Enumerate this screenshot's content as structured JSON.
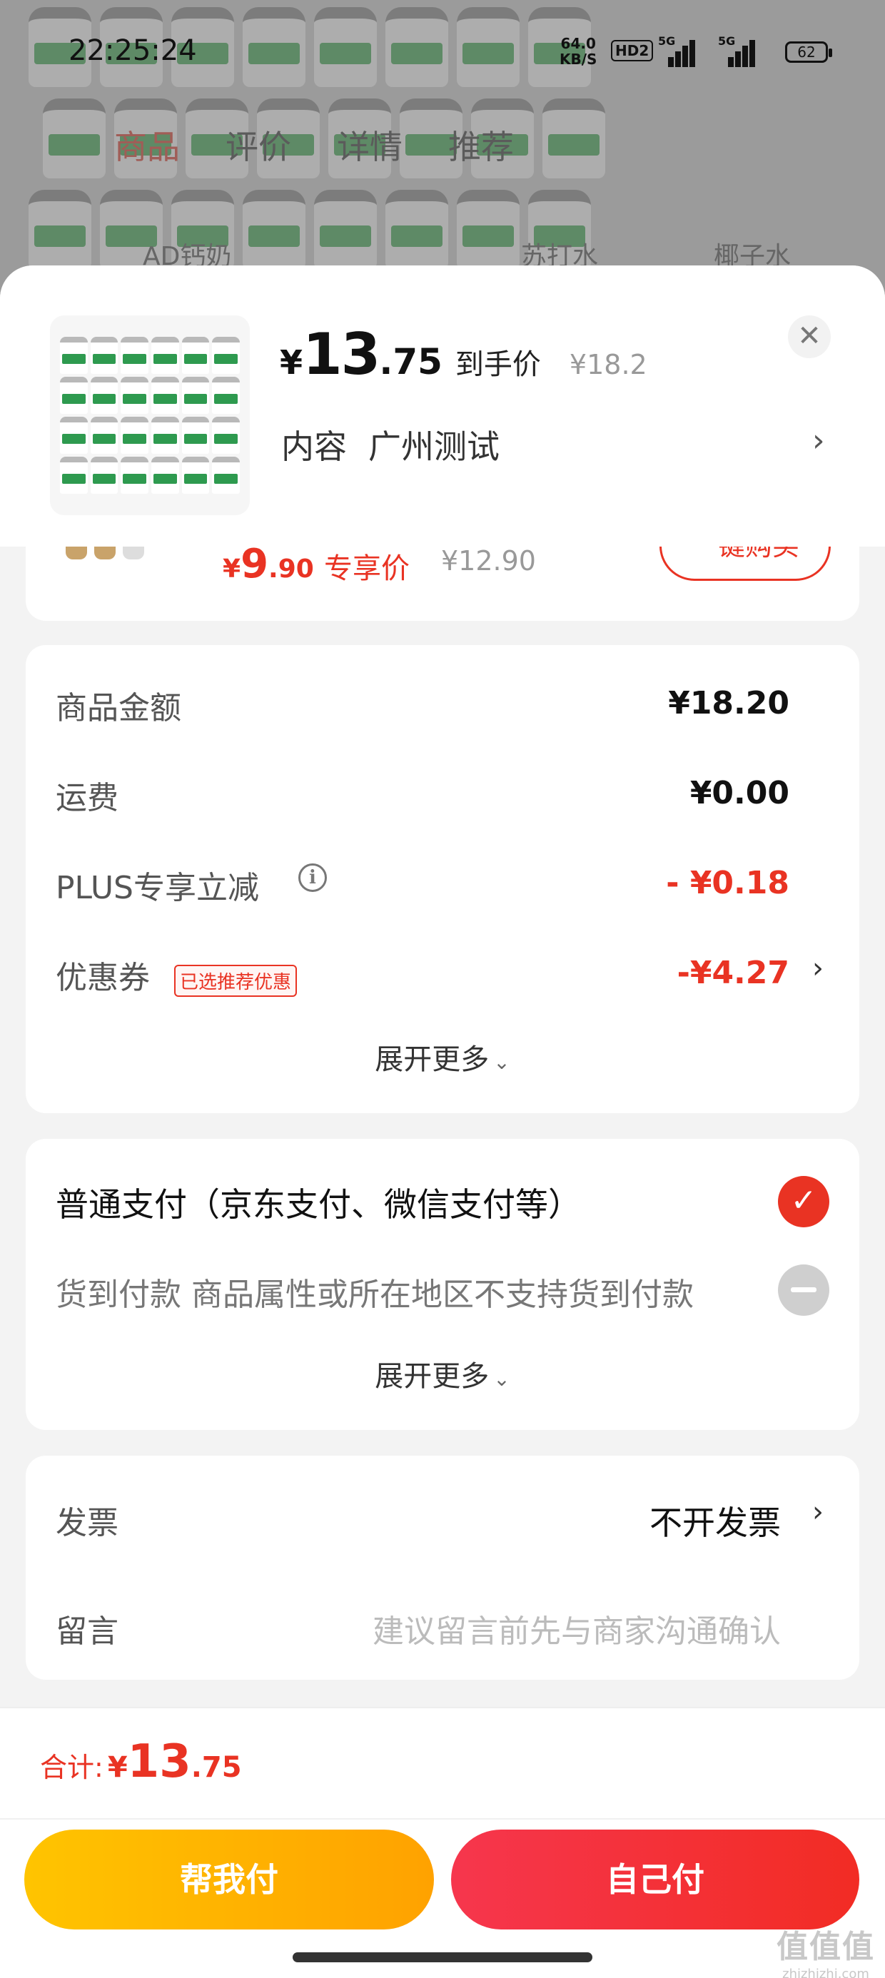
{
  "status_bar": {
    "time": "22:25:24",
    "net_speed": "64.0",
    "net_unit": "KB/S",
    "hd": "HD2",
    "sig1": "5G",
    "sig2": "5G",
    "battery": "62"
  },
  "background": {
    "tabs": [
      "商品",
      "评价",
      "详情",
      "推荐"
    ],
    "active_tab": "商品",
    "row_items": [
      "AD钙奶",
      "苏打水",
      "椰子水"
    ]
  },
  "product": {
    "price_currency": "¥",
    "price_int": "13",
    "price_dec": ".75",
    "price_tag": "到手价",
    "original_price": "¥18.2",
    "spec_label": "内容",
    "spec_value": "广州测试"
  },
  "recommend": {
    "price_currency": "¥",
    "price_int": "9",
    "price_dec": ".90",
    "price_tag": "专享价",
    "original_price": "¥12.90",
    "button_label": "一键购买"
  },
  "fees": {
    "goods_label": "商品金额",
    "goods_value": "¥18.20",
    "shipping_label": "运费",
    "shipping_value": "¥0.00",
    "plus_label": "PLUS专享立减",
    "plus_value": "- ¥0.18",
    "coupon_label": "优惠券",
    "coupon_badge": "已选推荐优惠",
    "coupon_value": "-¥4.27",
    "expand_label": "展开更多"
  },
  "payment": {
    "normal_label": "普通支付（京东支付、微信支付等）",
    "cod_label": "货到付款 商品属性或所在地区不支持货到付款",
    "expand_label": "展开更多"
  },
  "invoice": {
    "invoice_label": "发票",
    "invoice_value": "不开发票",
    "message_label": "留言",
    "message_placeholder": "建议留言前先与商家沟通确认"
  },
  "footer": {
    "total_label": "合计:",
    "total_currency": "¥",
    "total_int": "13",
    "total_dec": ".75",
    "help_pay_label": "帮我付",
    "self_pay_label": "自己付"
  },
  "watermark": {
    "line1": "值值值",
    "line2": "zhizhizhi.com"
  },
  "colors": {
    "accent_red": "#e93323",
    "help_pay_yellow": "#ffb300",
    "self_pay_red": "#f22c24"
  }
}
